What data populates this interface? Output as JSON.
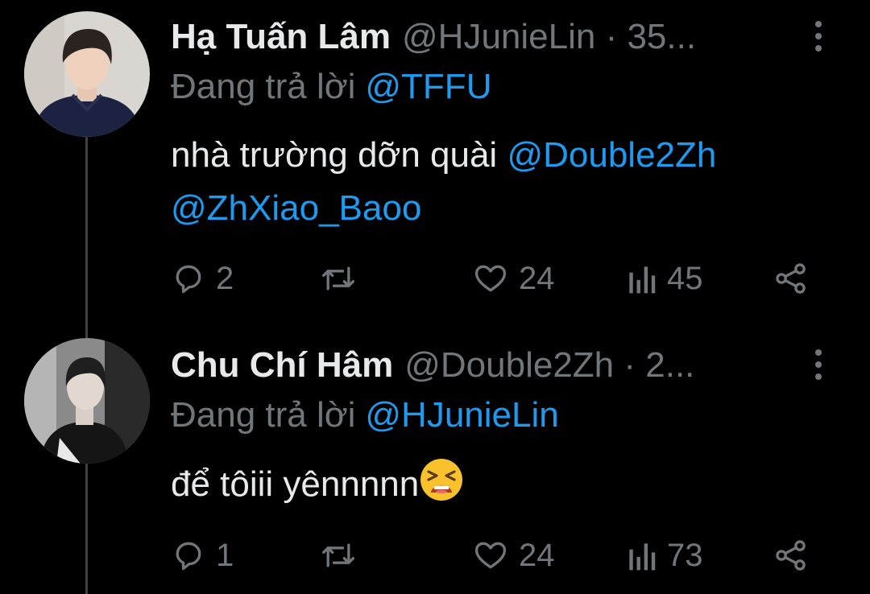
{
  "tweets": [
    {
      "name": "Hạ Tuấn Lâm",
      "handle": "@HJunieLin · 35...",
      "replying_label": "Đang trả lời",
      "replying_to": "@TFFU",
      "text": "nhà trường dỡn quài",
      "mentions": [
        "@Double2Zh",
        "@ZhXiao_Baoo"
      ],
      "reply_count": "2",
      "like_count": "24",
      "view_count": "45"
    },
    {
      "name": "Chu Chí Hâm",
      "handle": "@Double2Zh · 2...",
      "replying_label": "Đang trả lời",
      "replying_to": "@HJunieLin",
      "text": "để tôiii yênnnnn",
      "emoji": "tired-face-emoji",
      "reply_count": "1",
      "like_count": "24",
      "view_count": "73"
    }
  ],
  "colors": {
    "background": "#000000",
    "text": "#e7e9ea",
    "muted": "#71767b",
    "link": "#1d9bf0",
    "thread_line": "#3e4144"
  }
}
